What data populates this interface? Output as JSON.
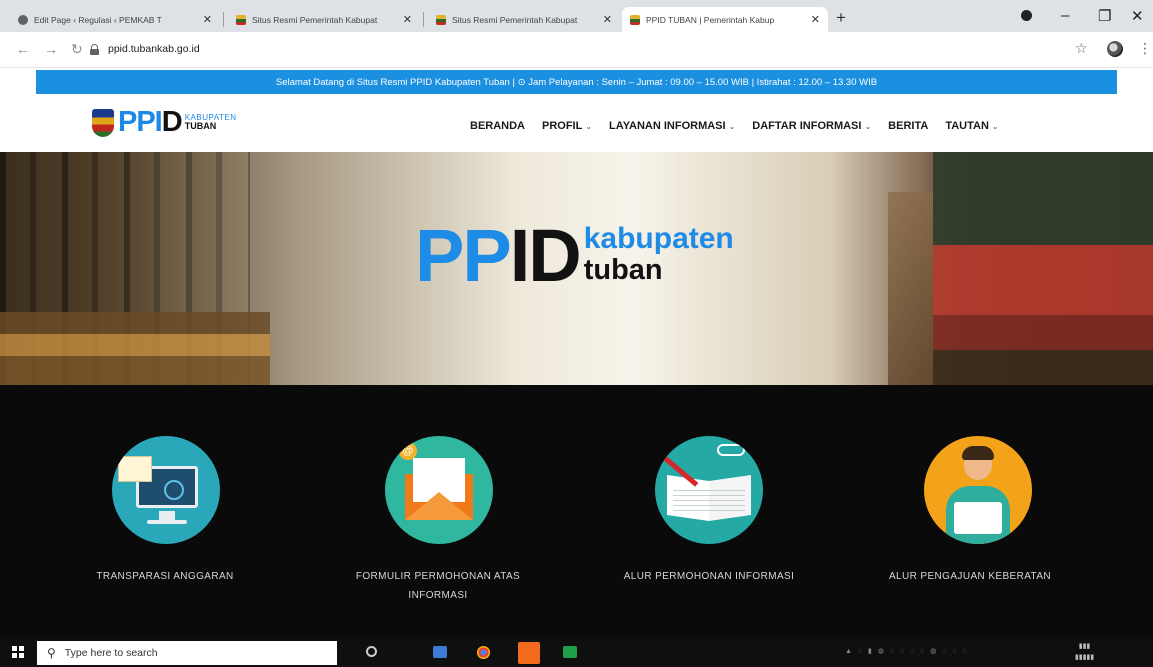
{
  "browser": {
    "tabs": [
      {
        "title": "Edit Page ‹ Regulasi ‹ PEMKAB T",
        "favicon": "edit-favicon-icon",
        "active": false
      },
      {
        "title": "Situs Resmi Pemerintah Kabupat",
        "favicon": "tuban-favicon-icon",
        "active": false
      },
      {
        "title": "Situs Resmi Pemerintah Kabupat",
        "favicon": "tuban-favicon-icon",
        "active": false
      },
      {
        "title": "PPID TUBAN | Pemerintah Kabup",
        "favicon": "tuban-favicon-icon",
        "active": true
      }
    ],
    "tab_close": "✕",
    "new_tab": "+",
    "url": "ppid.tubankab.go.id"
  },
  "site": {
    "announcement": "Selamat Datang di Situs Resmi PPID Kabupaten Tuban | ⊙ Jam Pelayanan : Senin – Jumat : 09.00 – 15.00 WIB | Istirahat : 12.00 – 13.30 WIB",
    "logo": {
      "ppi": "PPI",
      "d": "D",
      "kabupaten": "KABUPATEN",
      "tuban": "TUBAN"
    },
    "nav": [
      {
        "label": "BERANDA",
        "dropdown": false
      },
      {
        "label": "PROFIL",
        "dropdown": true
      },
      {
        "label": "LAYANAN INFORMASI",
        "dropdown": true
      },
      {
        "label": "DAFTAR INFORMASI",
        "dropdown": true
      },
      {
        "label": "BERITA",
        "dropdown": false
      },
      {
        "label": "TAUTAN",
        "dropdown": true
      }
    ],
    "hero": {
      "pp": "PP",
      "id": "ID",
      "kabupaten": "kabupaten",
      "tuban": "tuban"
    },
    "services": [
      {
        "label": "TRANSPARASI ANGGARAN",
        "icon": "monitor-budget-icon"
      },
      {
        "label": "FORMULIR PERMOHONAN ATAS INFORMASI",
        "icon": "envelope-form-icon"
      },
      {
        "label": "ALUR PERMOHONAN INFORMASI",
        "icon": "open-book-icon"
      },
      {
        "label": "ALUR PENGAJUAN KEBERATAN",
        "icon": "person-laptop-icon"
      }
    ]
  },
  "taskbar": {
    "search_placeholder": "Type here to search"
  },
  "colors": {
    "accent_blue": "#1b8fe0",
    "brand_blue": "#1e88e5",
    "services_bg": "#0a0a0a"
  }
}
